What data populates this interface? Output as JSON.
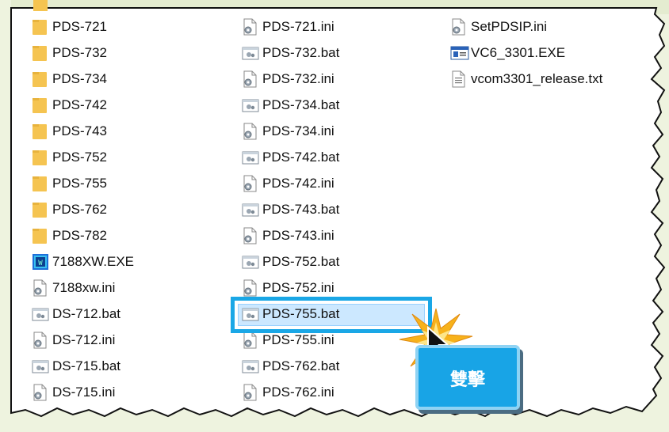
{
  "columns": [
    {
      "items": [
        {
          "name": "PDS-721",
          "type": "folder"
        },
        {
          "name": "PDS-732",
          "type": "folder"
        },
        {
          "name": "PDS-734",
          "type": "folder"
        },
        {
          "name": "PDS-742",
          "type": "folder"
        },
        {
          "name": "PDS-743",
          "type": "folder"
        },
        {
          "name": "PDS-752",
          "type": "folder"
        },
        {
          "name": "PDS-755",
          "type": "folder"
        },
        {
          "name": "PDS-762",
          "type": "folder"
        },
        {
          "name": "PDS-782",
          "type": "folder"
        },
        {
          "name": "7188XW.EXE",
          "type": "exe-app"
        },
        {
          "name": "7188xw.ini",
          "type": "ini"
        },
        {
          "name": "DS-712.bat",
          "type": "bat"
        },
        {
          "name": "DS-712.ini",
          "type": "ini"
        },
        {
          "name": "DS-715.bat",
          "type": "bat"
        },
        {
          "name": "DS-715.ini",
          "type": "ini"
        }
      ]
    },
    {
      "items": [
        {
          "name": "PDS-721.ini",
          "type": "ini"
        },
        {
          "name": "PDS-732.bat",
          "type": "bat"
        },
        {
          "name": "PDS-732.ini",
          "type": "ini"
        },
        {
          "name": "PDS-734.bat",
          "type": "bat"
        },
        {
          "name": "PDS-734.ini",
          "type": "ini"
        },
        {
          "name": "PDS-742.bat",
          "type": "bat"
        },
        {
          "name": "PDS-742.ini",
          "type": "ini"
        },
        {
          "name": "PDS-743.bat",
          "type": "bat"
        },
        {
          "name": "PDS-743.ini",
          "type": "ini"
        },
        {
          "name": "PDS-752.bat",
          "type": "bat"
        },
        {
          "name": "PDS-752.ini",
          "type": "ini"
        },
        {
          "name": "PDS-755.bat",
          "type": "bat",
          "selected": true
        },
        {
          "name": "PDS-755.ini",
          "type": "ini"
        },
        {
          "name": "PDS-762.bat",
          "type": "bat"
        },
        {
          "name": "PDS-762.ini",
          "type": "ini"
        }
      ]
    },
    {
      "items": [
        {
          "name": "SetPDSIP.ini",
          "type": "ini"
        },
        {
          "name": "VC6_3301.EXE",
          "type": "exe-window"
        },
        {
          "name": "vcom3301_release.txt",
          "type": "txt"
        }
      ]
    }
  ],
  "callout": {
    "label": "雙擊"
  },
  "colors": {
    "selection_outline": "#1aa7e6",
    "selection_fill": "#cce8ff",
    "badge": "#18a4e6",
    "folder": "#f5c451",
    "page_background": "#eef3df"
  },
  "icons": {
    "folder": "folder-icon",
    "ini": "settings-file-icon",
    "bat": "batch-file-icon",
    "exe-app": "application-icon",
    "exe-window": "window-app-icon",
    "txt": "text-file-icon",
    "cursor": "mouse-pointer-icon",
    "click": "click-burst-icon"
  }
}
